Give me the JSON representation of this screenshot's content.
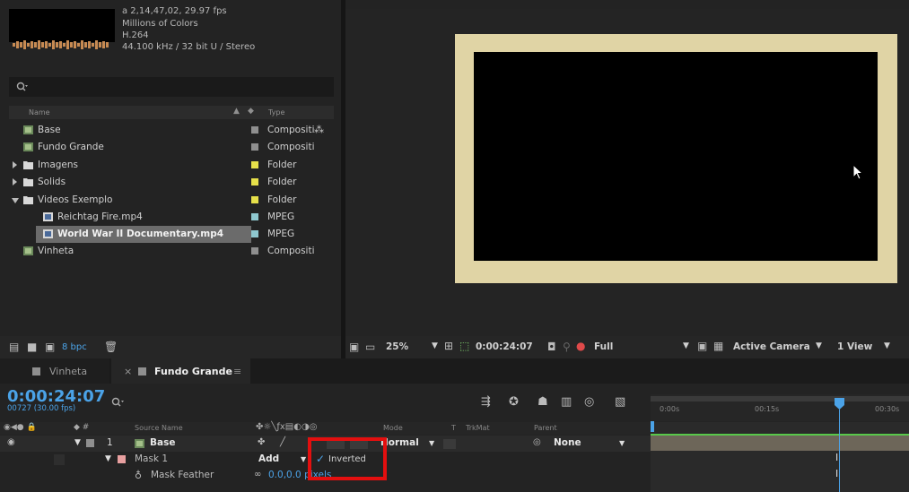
{
  "project": {
    "meta": [
      "a 2,14,47,02, 29.97 fps",
      "Millions of Colors",
      "H.264",
      "44.100 kHz / 32 bit U / Stereo"
    ],
    "search_icon": "search-icon",
    "columns": {
      "name": "Name",
      "type": "Type"
    },
    "items": [
      {
        "name": "Base",
        "type": "Compositi",
        "kind": "comp",
        "color": "#8f8f8f"
      },
      {
        "name": "Fundo Grande",
        "type": "Compositi",
        "kind": "comp",
        "color": "#8f8f8f"
      },
      {
        "name": "Imagens",
        "type": "Folder",
        "kind": "folder",
        "color": "#e6e04a"
      },
      {
        "name": "Solids",
        "type": "Folder",
        "kind": "folder",
        "color": "#e6e04a"
      },
      {
        "name": "Videos Exemplo",
        "type": "Folder",
        "kind": "folder",
        "color": "#e6e04a"
      },
      {
        "name": "Reichtag Fire.mp4",
        "type": "MPEG",
        "kind": "file",
        "color": "#8fc8cf"
      },
      {
        "name": "World War II Documentary.mp4",
        "type": "MPEG",
        "kind": "file",
        "color": "#8fc8cf"
      },
      {
        "name": "Vinheta",
        "type": "Compositi",
        "kind": "comp",
        "color": "#8f8f8f"
      }
    ],
    "bpc": "8 bpc"
  },
  "viewer": {
    "zoom": "25%",
    "timecode": "0:00:24:07",
    "resolution": "Full",
    "camera": "Active Camera",
    "view": "1 View"
  },
  "tabs": [
    {
      "label": "Vinheta",
      "color": "#8f8f8f"
    },
    {
      "label": "Fundo Grande",
      "color": "#8f8f8f"
    }
  ],
  "timeline": {
    "timecode": "0:00:24:07",
    "frames": "00727 (30.00 fps)",
    "columns": {
      "source": "Source Name",
      "mode": "Mode",
      "t": "T",
      "trkmat": "TrkMat",
      "parent": "Parent"
    },
    "layer": {
      "num": "1",
      "name": "Base",
      "mode": "Normal",
      "parent": "None"
    },
    "mask": {
      "name": "Mask 1",
      "mode": "Add",
      "inverted": "Inverted"
    },
    "feather": {
      "label": "Mask Feather",
      "value": "0.0,0.0 pixels"
    },
    "ruler": [
      "0:00s",
      "00:15s",
      "00:30s"
    ]
  },
  "colors": {
    "accent": "#4ba3e8",
    "highlight": "#e30f0f",
    "frame": "#e0d4a5"
  }
}
